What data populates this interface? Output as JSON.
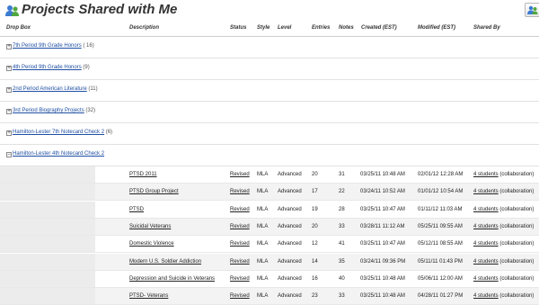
{
  "header": {
    "title": "Projects Shared with Me"
  },
  "columns": {
    "drop_box": "Drop Box",
    "description": "Description",
    "status": "Status",
    "style": "Style",
    "level": "Level",
    "entries": "Entries",
    "notes": "Notes",
    "created": "Created (EST)",
    "modified": "Modified (EST)",
    "shared_by": "Shared By"
  },
  "drop_boxes": [
    {
      "name": "7th Period 9th Grade Honors",
      "count": "( 16)"
    },
    {
      "name": "4th Period 9th Grade Honors",
      "count": "(9)"
    },
    {
      "name": "2nd Period American Literature",
      "count": "(11)"
    },
    {
      "name": "3rd Period Biography Projects",
      "count": "(32)"
    },
    {
      "name": "Hamilton-Lester 7th Notecard Check 2",
      "count": "(6)"
    },
    {
      "name": "Hamilton-Lester 4th Notecard Check 2",
      "count": ""
    }
  ],
  "entries": [
    {
      "description": "PTSD 2011",
      "status": "Revised",
      "style": "MLA",
      "level": "Advanced",
      "entries": "20",
      "notes": "31",
      "created": "03/25/11 10:48 AM",
      "modified": "02/01/12 12:28 AM",
      "shared_link": "4 students",
      "shared_suffix": "(collaboration)"
    },
    {
      "description": "PTSD Group Project",
      "status": "Revised",
      "style": "MLA",
      "level": "Advanced",
      "entries": "17",
      "notes": "22",
      "created": "03/24/11 10:52 AM",
      "modified": "01/01/12 10:54 AM",
      "shared_link": "4 students",
      "shared_suffix": "(collaboration)"
    },
    {
      "description": "PTSD",
      "status": "Revised",
      "style": "MLA",
      "level": "Advanced",
      "entries": "19",
      "notes": "28",
      "created": "03/25/11 10:47 AM",
      "modified": "01/11/12 11:03 AM",
      "shared_link": "4 students",
      "shared_suffix": "(collaboration)"
    },
    {
      "description": "Suicidal Veterans",
      "status": "Revised",
      "style": "MLA",
      "level": "Advanced",
      "entries": "20",
      "notes": "33",
      "created": "03/28/11 11:12 AM",
      "modified": "05/25/11 09:55 AM",
      "shared_link": "4 students",
      "shared_suffix": "(collaboration)"
    },
    {
      "description": "Domestic Violence",
      "status": "Revised",
      "style": "MLA",
      "level": "Advanced",
      "entries": "12",
      "notes": "41",
      "created": "03/25/11 10:47 AM",
      "modified": "05/12/11 08:55 AM",
      "shared_link": "4 students",
      "shared_suffix": "(collaboration)"
    },
    {
      "description": "Modern U.S. Soldier Addiction",
      "status": "Revised",
      "style": "MLA",
      "level": "Advanced",
      "entries": "14",
      "notes": "35",
      "created": "03/24/11 09:36 PM",
      "modified": "05/11/11 01:43 PM",
      "shared_link": "4 students",
      "shared_suffix": "(collaboration)"
    },
    {
      "description": "Depression and Suicide in Veterans",
      "status": "Revised",
      "style": "MLA",
      "level": "Advanced",
      "entries": "16",
      "notes": "40",
      "created": "03/25/11 10:48 AM",
      "modified": "05/06/11 12:00 AM",
      "shared_link": "4 students",
      "shared_suffix": "(collaboration)"
    },
    {
      "description": "PTSD- Veterans",
      "status": "Revised",
      "style": "MLA",
      "level": "Advanced",
      "entries": "23",
      "notes": "33",
      "created": "03/25/11 10:48 AM",
      "modified": "04/28/11 01:27 PM",
      "shared_link": "4 students",
      "shared_suffix": "(collaboration)"
    }
  ],
  "icons": {
    "title_icon": "users-group-icon",
    "corner_icon": "users-share-icon",
    "expand_icon": "plus-box-icon",
    "collapse_icon": "minus-box-icon"
  }
}
